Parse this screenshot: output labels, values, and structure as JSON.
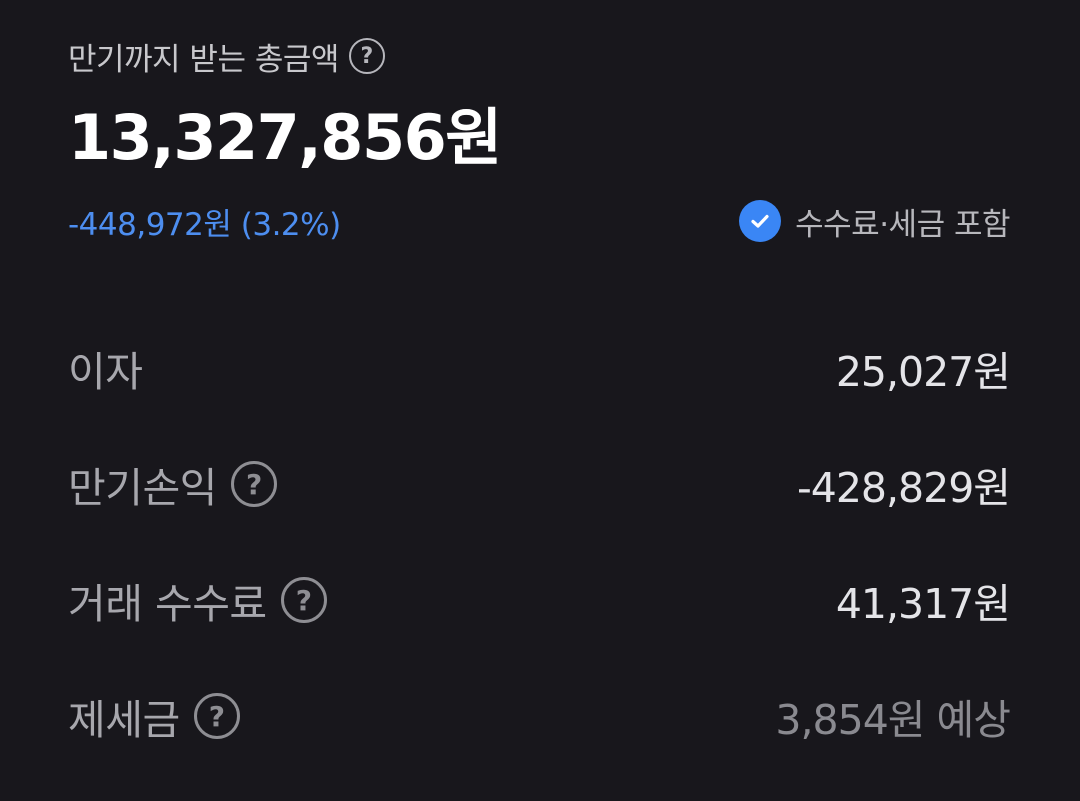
{
  "header": {
    "title": "만기까지 받는 총금액",
    "help_icon": "question-circle-icon"
  },
  "summary": {
    "total": "13,327,856원",
    "difference": "-448,972원 (3.2%)",
    "included_note": "수수료·세금 포함",
    "included_icon": "check-circle-icon"
  },
  "details": {
    "rows": [
      {
        "label": "이자",
        "value": "25,027원",
        "has_help": false
      },
      {
        "label": "만기손익",
        "value": "-428,829원",
        "has_help": true
      },
      {
        "label": "거래 수수료",
        "value": "41,317원",
        "has_help": true
      },
      {
        "label": "제세금",
        "value": "3,854원 예상",
        "has_help": true
      }
    ]
  },
  "colors": {
    "background": "#18171c",
    "accent_blue": "#4d8ef0",
    "check_blue": "#3a86f5",
    "label_gray": "#a7a7ad",
    "value_white": "#e4e4e8"
  }
}
